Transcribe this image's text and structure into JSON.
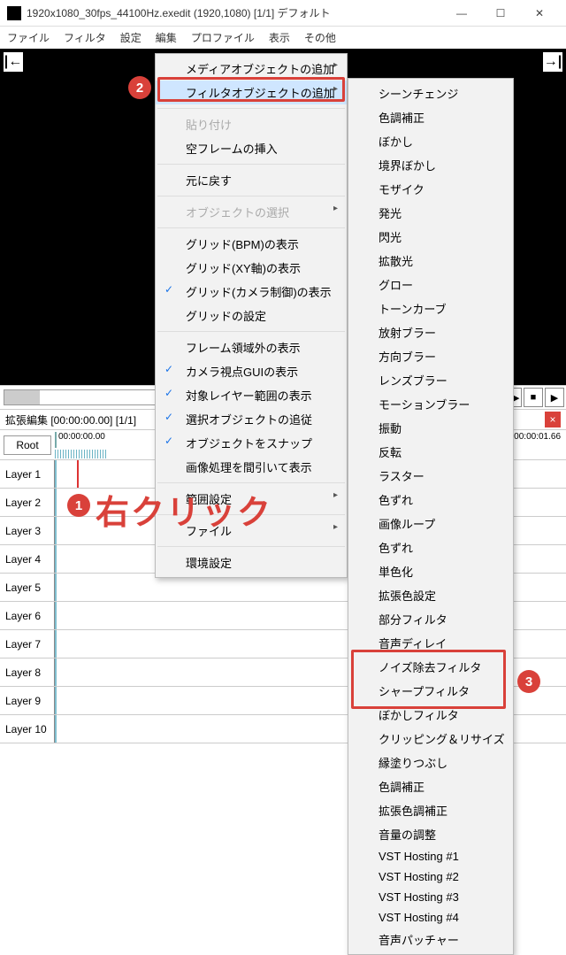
{
  "window": {
    "title": "1920x1080_30fps_44100Hz.exedit (1920,1080)  [1/1]  デフォルト",
    "controls": {
      "min": "—",
      "max": "☐",
      "close": "✕"
    }
  },
  "menubar": [
    "ファイル",
    "フィルタ",
    "設定",
    "編集",
    "プロファイル",
    "表示",
    "その他"
  ],
  "nav": {
    "goStart": "|←",
    "goEnd": "→|"
  },
  "transport": [
    "▶|",
    "|◀",
    "◀◀",
    "▶▶",
    "■",
    "▶"
  ],
  "editor": {
    "header": "拡張編集 [00:00:00.00] [1/1]",
    "root": "Root",
    "close": "×"
  },
  "ruler": {
    "t0": "00:00:00.00",
    "t1": "00:00:01.66"
  },
  "layers": [
    "Layer 1",
    "Layer 2",
    "Layer 3",
    "Layer 4",
    "Layer 5",
    "Layer 6",
    "Layer 7",
    "Layer 8",
    "Layer 9",
    "Layer 10"
  ],
  "menu1": [
    {
      "label": "メディアオブジェクトの追加",
      "sub": true
    },
    {
      "label": "フィルタオブジェクトの追加",
      "sub": true,
      "hl": true
    },
    {
      "sep": true
    },
    {
      "label": "貼り付け",
      "disabled": true
    },
    {
      "label": "空フレームの挿入"
    },
    {
      "sep": true
    },
    {
      "label": "元に戻す"
    },
    {
      "sep": true
    },
    {
      "label": "オブジェクトの選択",
      "sub": true,
      "disabled": true
    },
    {
      "sep": true
    },
    {
      "label": "グリッド(BPM)の表示"
    },
    {
      "label": "グリッド(XY軸)の表示"
    },
    {
      "label": "グリッド(カメラ制御)の表示",
      "check": true
    },
    {
      "label": "グリッドの設定"
    },
    {
      "sep": true
    },
    {
      "label": "フレーム領域外の表示"
    },
    {
      "label": "カメラ視点GUIの表示",
      "check": true
    },
    {
      "label": "対象レイヤー範囲の表示",
      "check": true
    },
    {
      "label": "選択オブジェクトの追従",
      "check": true
    },
    {
      "label": "オブジェクトをスナップ",
      "check": true
    },
    {
      "label": "画像処理を間引いて表示"
    },
    {
      "sep": true
    },
    {
      "label": "範囲設定",
      "sub": true
    },
    {
      "sep": true
    },
    {
      "label": "ファイル",
      "sub": true
    },
    {
      "sep": true
    },
    {
      "label": "環境設定"
    }
  ],
  "menu2": [
    "シーンチェンジ",
    "色調補正",
    "ぼかし",
    "境界ぼかし",
    "モザイク",
    "発光",
    "閃光",
    "拡散光",
    "グロー",
    "トーンカーブ",
    "放射ブラー",
    "方向ブラー",
    "レンズブラー",
    "モーションブラー",
    "振動",
    "反転",
    "ラスター",
    "色ずれ",
    "画像ループ",
    "色ずれ",
    "単色化",
    "拡張色設定",
    "部分フィルタ",
    "音声ディレイ",
    "ノイズ除去フィルタ",
    "シャープフィルタ",
    "ぼかしフィルタ",
    "クリッピング＆リサイズ",
    "縁塗りつぶし",
    "色調補正",
    "拡張色調補正",
    "音量の調整",
    "VST Hosting #1",
    "VST Hosting #2",
    "VST Hosting #3",
    "VST Hosting #4",
    "音声パッチャー"
  ],
  "annotations": {
    "b1": "1",
    "b2": "2",
    "b3": "3",
    "text": "右クリック"
  }
}
